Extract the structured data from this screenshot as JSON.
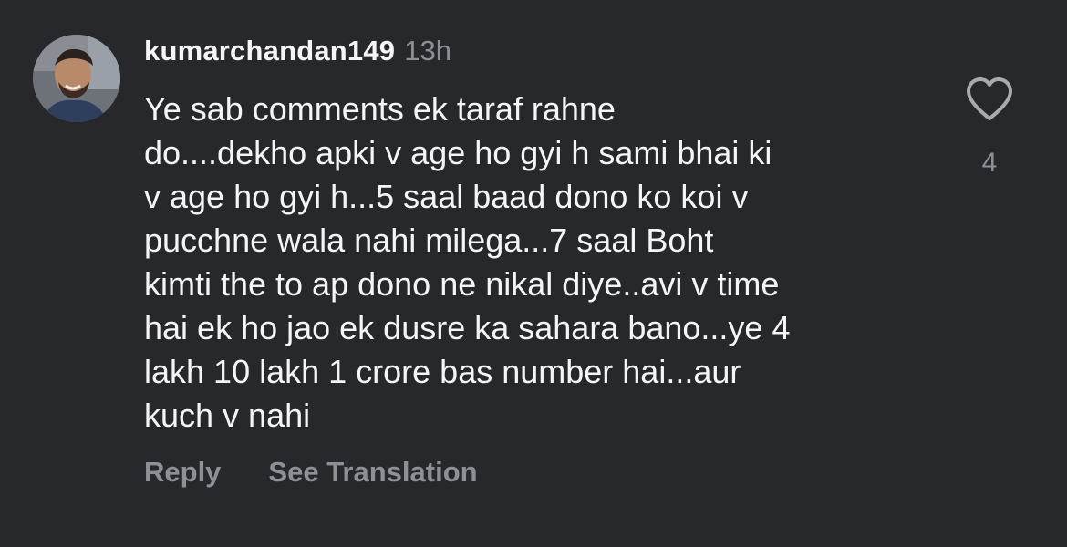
{
  "comment": {
    "username": "kumarchandan149",
    "timestamp": "13h",
    "lines": [
      "Ye sab comments ek taraf rahne",
      "do....dekho apki v age ho gyi h sami bhai ki",
      "v age ho gyi h...5 saal baad dono ko koi v",
      "pucchne wala nahi milega...7 saal Boht",
      "kimti the to ap dono ne nikal diye..avi v time",
      "hai ek ho jao ek dusre ka sahara bano...ye 4",
      "lakh 10 lakh 1 crore bas number hai...aur",
      "kuch v nahi"
    ],
    "like_count": "4",
    "like_icon": "heart-outline-icon"
  },
  "actions": {
    "reply_label": "Reply",
    "translate_label": "See Translation"
  },
  "colors": {
    "background": "#26282c",
    "primary_text": "#f5f5f5",
    "secondary_text": "#8e9097"
  }
}
